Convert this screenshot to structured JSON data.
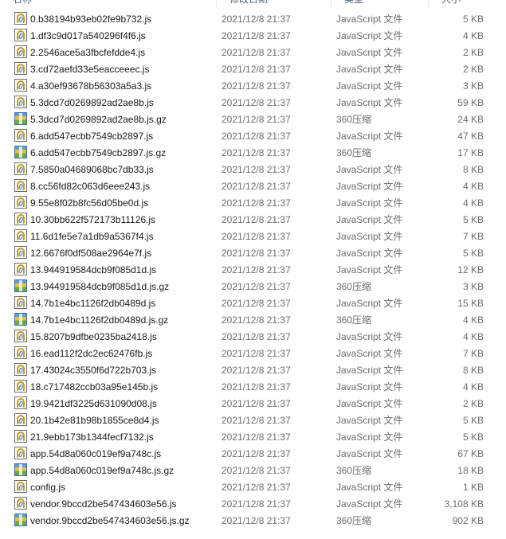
{
  "columns": {
    "name": "名称",
    "date": "修改日期",
    "type": "类型",
    "size": "大小"
  },
  "files": [
    {
      "icon": "js-file-icon",
      "kind": "js",
      "name": "0.b38194b93eb02fe9b732.js",
      "date": "2021/12/8 21:37",
      "type": "JavaScript 文件",
      "size": "5 KB"
    },
    {
      "icon": "js-file-icon",
      "kind": "js",
      "name": "1.df3c9d017a540296f4f6.js",
      "date": "2021/12/8 21:37",
      "type": "JavaScript 文件",
      "size": "4 KB"
    },
    {
      "icon": "js-file-icon",
      "kind": "js",
      "name": "2.2546ace5a3fbcfefdde4.js",
      "date": "2021/12/8 21:37",
      "type": "JavaScript 文件",
      "size": "2 KB"
    },
    {
      "icon": "js-file-icon",
      "kind": "js",
      "name": "3.cd72aefd33e5eacceeec.js",
      "date": "2021/12/8 21:37",
      "type": "JavaScript 文件",
      "size": "2 KB"
    },
    {
      "icon": "js-file-icon",
      "kind": "js",
      "name": "4.a30ef93678b56303a5a3.js",
      "date": "2021/12/8 21:37",
      "type": "JavaScript 文件",
      "size": "3 KB"
    },
    {
      "icon": "js-file-icon",
      "kind": "js",
      "name": "5.3dcd7d0269892ad2ae8b.js",
      "date": "2021/12/8 21:37",
      "type": "JavaScript 文件",
      "size": "59 KB"
    },
    {
      "icon": "archive-icon",
      "kind": "gz",
      "name": "5.3dcd7d0269892ad2ae8b.js.gz",
      "date": "2021/12/8 21:37",
      "type": "360压缩",
      "size": "24 KB"
    },
    {
      "icon": "js-file-icon",
      "kind": "js",
      "name": "6.add547ecbb7549cb2897.js",
      "date": "2021/12/8 21:37",
      "type": "JavaScript 文件",
      "size": "47 KB"
    },
    {
      "icon": "archive-icon",
      "kind": "gz",
      "name": "6.add547ecbb7549cb2897.js.gz",
      "date": "2021/12/8 21:37",
      "type": "360压缩",
      "size": "17 KB"
    },
    {
      "icon": "js-file-icon",
      "kind": "js",
      "name": "7.5850a04689068bc7db33.js",
      "date": "2021/12/8 21:37",
      "type": "JavaScript 文件",
      "size": "8 KB"
    },
    {
      "icon": "js-file-icon",
      "kind": "js",
      "name": "8.cc56fd82c063d6eee243.js",
      "date": "2021/12/8 21:37",
      "type": "JavaScript 文件",
      "size": "4 KB"
    },
    {
      "icon": "js-file-icon",
      "kind": "js",
      "name": "9.55e8f02b8fc56d05be0d.js",
      "date": "2021/12/8 21:37",
      "type": "JavaScript 文件",
      "size": "4 KB"
    },
    {
      "icon": "js-file-icon",
      "kind": "js",
      "name": "10.30bb622f572173b11126.js",
      "date": "2021/12/8 21:37",
      "type": "JavaScript 文件",
      "size": "5 KB"
    },
    {
      "icon": "js-file-icon",
      "kind": "js",
      "name": "11.6d1fe5e7a1db9a5367f4.js",
      "date": "2021/12/8 21:37",
      "type": "JavaScript 文件",
      "size": "7 KB"
    },
    {
      "icon": "js-file-icon",
      "kind": "js",
      "name": "12.6676f0df508ae2964e7f.js",
      "date": "2021/12/8 21:37",
      "type": "JavaScript 文件",
      "size": "5 KB"
    },
    {
      "icon": "js-file-icon",
      "kind": "js",
      "name": "13.944919584dcb9f085d1d.js",
      "date": "2021/12/8 21:37",
      "type": "JavaScript 文件",
      "size": "12 KB"
    },
    {
      "icon": "archive-icon",
      "kind": "gz",
      "name": "13.944919584dcb9f085d1d.js.gz",
      "date": "2021/12/8 21:37",
      "type": "360压缩",
      "size": "3 KB"
    },
    {
      "icon": "js-file-icon",
      "kind": "js",
      "name": "14.7b1e4bc1126f2db0489d.js",
      "date": "2021/12/8 21:37",
      "type": "JavaScript 文件",
      "size": "15 KB"
    },
    {
      "icon": "archive-icon",
      "kind": "gz",
      "name": "14.7b1e4bc1126f2db0489d.js.gz",
      "date": "2021/12/8 21:37",
      "type": "360压缩",
      "size": "4 KB"
    },
    {
      "icon": "js-file-icon",
      "kind": "js",
      "name": "15.8207b9dfbe0235ba2418.js",
      "date": "2021/12/8 21:37",
      "type": "JavaScript 文件",
      "size": "4 KB"
    },
    {
      "icon": "js-file-icon",
      "kind": "js",
      "name": "16.ead112f2dc2ec62476fb.js",
      "date": "2021/12/8 21:37",
      "type": "JavaScript 文件",
      "size": "7 KB"
    },
    {
      "icon": "js-file-icon",
      "kind": "js",
      "name": "17.43024c3550f6d722b703.js",
      "date": "2021/12/8 21:37",
      "type": "JavaScript 文件",
      "size": "8 KB"
    },
    {
      "icon": "js-file-icon",
      "kind": "js",
      "name": "18.c717482ccb03a95e145b.js",
      "date": "2021/12/8 21:37",
      "type": "JavaScript 文件",
      "size": "4 KB"
    },
    {
      "icon": "js-file-icon",
      "kind": "js",
      "name": "19.9421df3225d631090d08.js",
      "date": "2021/12/8 21:37",
      "type": "JavaScript 文件",
      "size": "2 KB"
    },
    {
      "icon": "js-file-icon",
      "kind": "js",
      "name": "20.1b42e81b98b1855ce8d4.js",
      "date": "2021/12/8 21:37",
      "type": "JavaScript 文件",
      "size": "5 KB"
    },
    {
      "icon": "js-file-icon",
      "kind": "js",
      "name": "21.9ebb173b1344fecf7132.js",
      "date": "2021/12/8 21:37",
      "type": "JavaScript 文件",
      "size": "5 KB"
    },
    {
      "icon": "js-file-icon",
      "kind": "js",
      "name": "app.54d8a060c019ef9a748c.js",
      "date": "2021/12/8 21:37",
      "type": "JavaScript 文件",
      "size": "67 KB"
    },
    {
      "icon": "archive-icon",
      "kind": "gz",
      "name": "app.54d8a060c019ef9a748c.js.gz",
      "date": "2021/12/8 21:37",
      "type": "360压缩",
      "size": "18 KB"
    },
    {
      "icon": "js-file-icon",
      "kind": "js",
      "name": "config.js",
      "date": "2021/12/8 21:37",
      "type": "JavaScript 文件",
      "size": "1 KB"
    },
    {
      "icon": "js-file-icon",
      "kind": "js",
      "name": "vendor.9bccd2be547434603e56.js",
      "date": "2021/12/8 21:37",
      "type": "JavaScript 文件",
      "size": "3,108 KB"
    },
    {
      "icon": "archive-icon",
      "kind": "gz",
      "name": "vendor.9bccd2be547434603e56.js.gz",
      "date": "2021/12/8 21:37",
      "type": "360压缩",
      "size": "902 KB"
    }
  ]
}
